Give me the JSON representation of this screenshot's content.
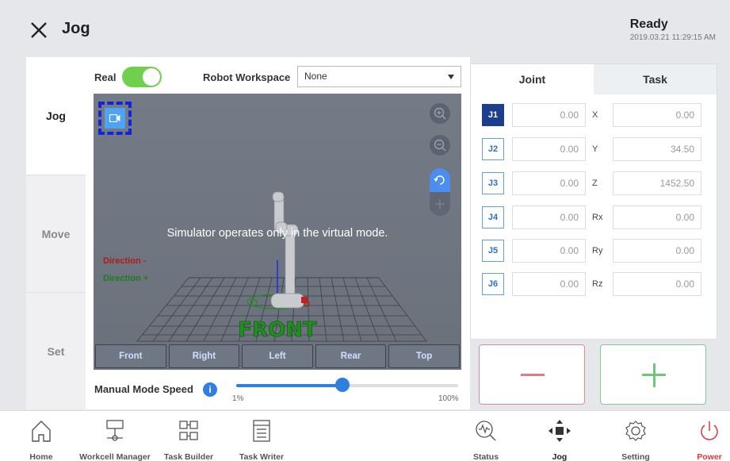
{
  "header": {
    "title": "Jog",
    "status": "Ready",
    "datetime": "2019.03.21 11:29:15 AM"
  },
  "sidebar": {
    "items": [
      {
        "label": "Jog",
        "active": true
      },
      {
        "label": "Move",
        "active": false
      },
      {
        "label": "Set",
        "active": false
      }
    ]
  },
  "controls": {
    "real_label": "Real",
    "real_on": true,
    "workspace_label": "Robot Workspace",
    "workspace_value": "None"
  },
  "simulator": {
    "message": "Simulator operates only in the virtual mode.",
    "direction_minus": "Direction -",
    "direction_plus": "Direction +",
    "floor_label": "FRONT",
    "views": [
      "Front",
      "Right",
      "Left",
      "Rear",
      "Top"
    ]
  },
  "speed": {
    "label": "Manual Mode Speed",
    "min_label": "1%",
    "max_label": "100%",
    "value_percent": 48
  },
  "coords": {
    "tabs": [
      "Joint",
      "Task"
    ],
    "active_tab": "Joint",
    "joints": [
      {
        "name": "J1",
        "value": "0.00",
        "selected": true
      },
      {
        "name": "J2",
        "value": "0.00",
        "selected": false
      },
      {
        "name": "J3",
        "value": "0.00",
        "selected": false
      },
      {
        "name": "J4",
        "value": "0.00",
        "selected": false
      },
      {
        "name": "J5",
        "value": "0.00",
        "selected": false
      },
      {
        "name": "J6",
        "value": "0.00",
        "selected": false
      }
    ],
    "task": [
      {
        "name": "X",
        "value": "0.00"
      },
      {
        "name": "Y",
        "value": "34.50"
      },
      {
        "name": "Z",
        "value": "1452.50"
      },
      {
        "name": "Rx",
        "value": "0.00"
      },
      {
        "name": "Ry",
        "value": "0.00"
      },
      {
        "name": "Rz",
        "value": "0.00"
      }
    ]
  },
  "nav": {
    "items": [
      {
        "label": "Home",
        "icon": "home-icon"
      },
      {
        "label": "Workcell Manager",
        "icon": "workcell-icon"
      },
      {
        "label": "Task Builder",
        "icon": "task-builder-icon"
      },
      {
        "label": "Task Writer",
        "icon": "task-writer-icon"
      },
      {
        "label": "Status",
        "icon": "status-icon"
      },
      {
        "label": "Jog",
        "icon": "jog-icon"
      },
      {
        "label": "Setting",
        "icon": "gear-icon"
      },
      {
        "label": "Power",
        "icon": "power-icon"
      }
    ],
    "power_color": "#e0343c"
  }
}
